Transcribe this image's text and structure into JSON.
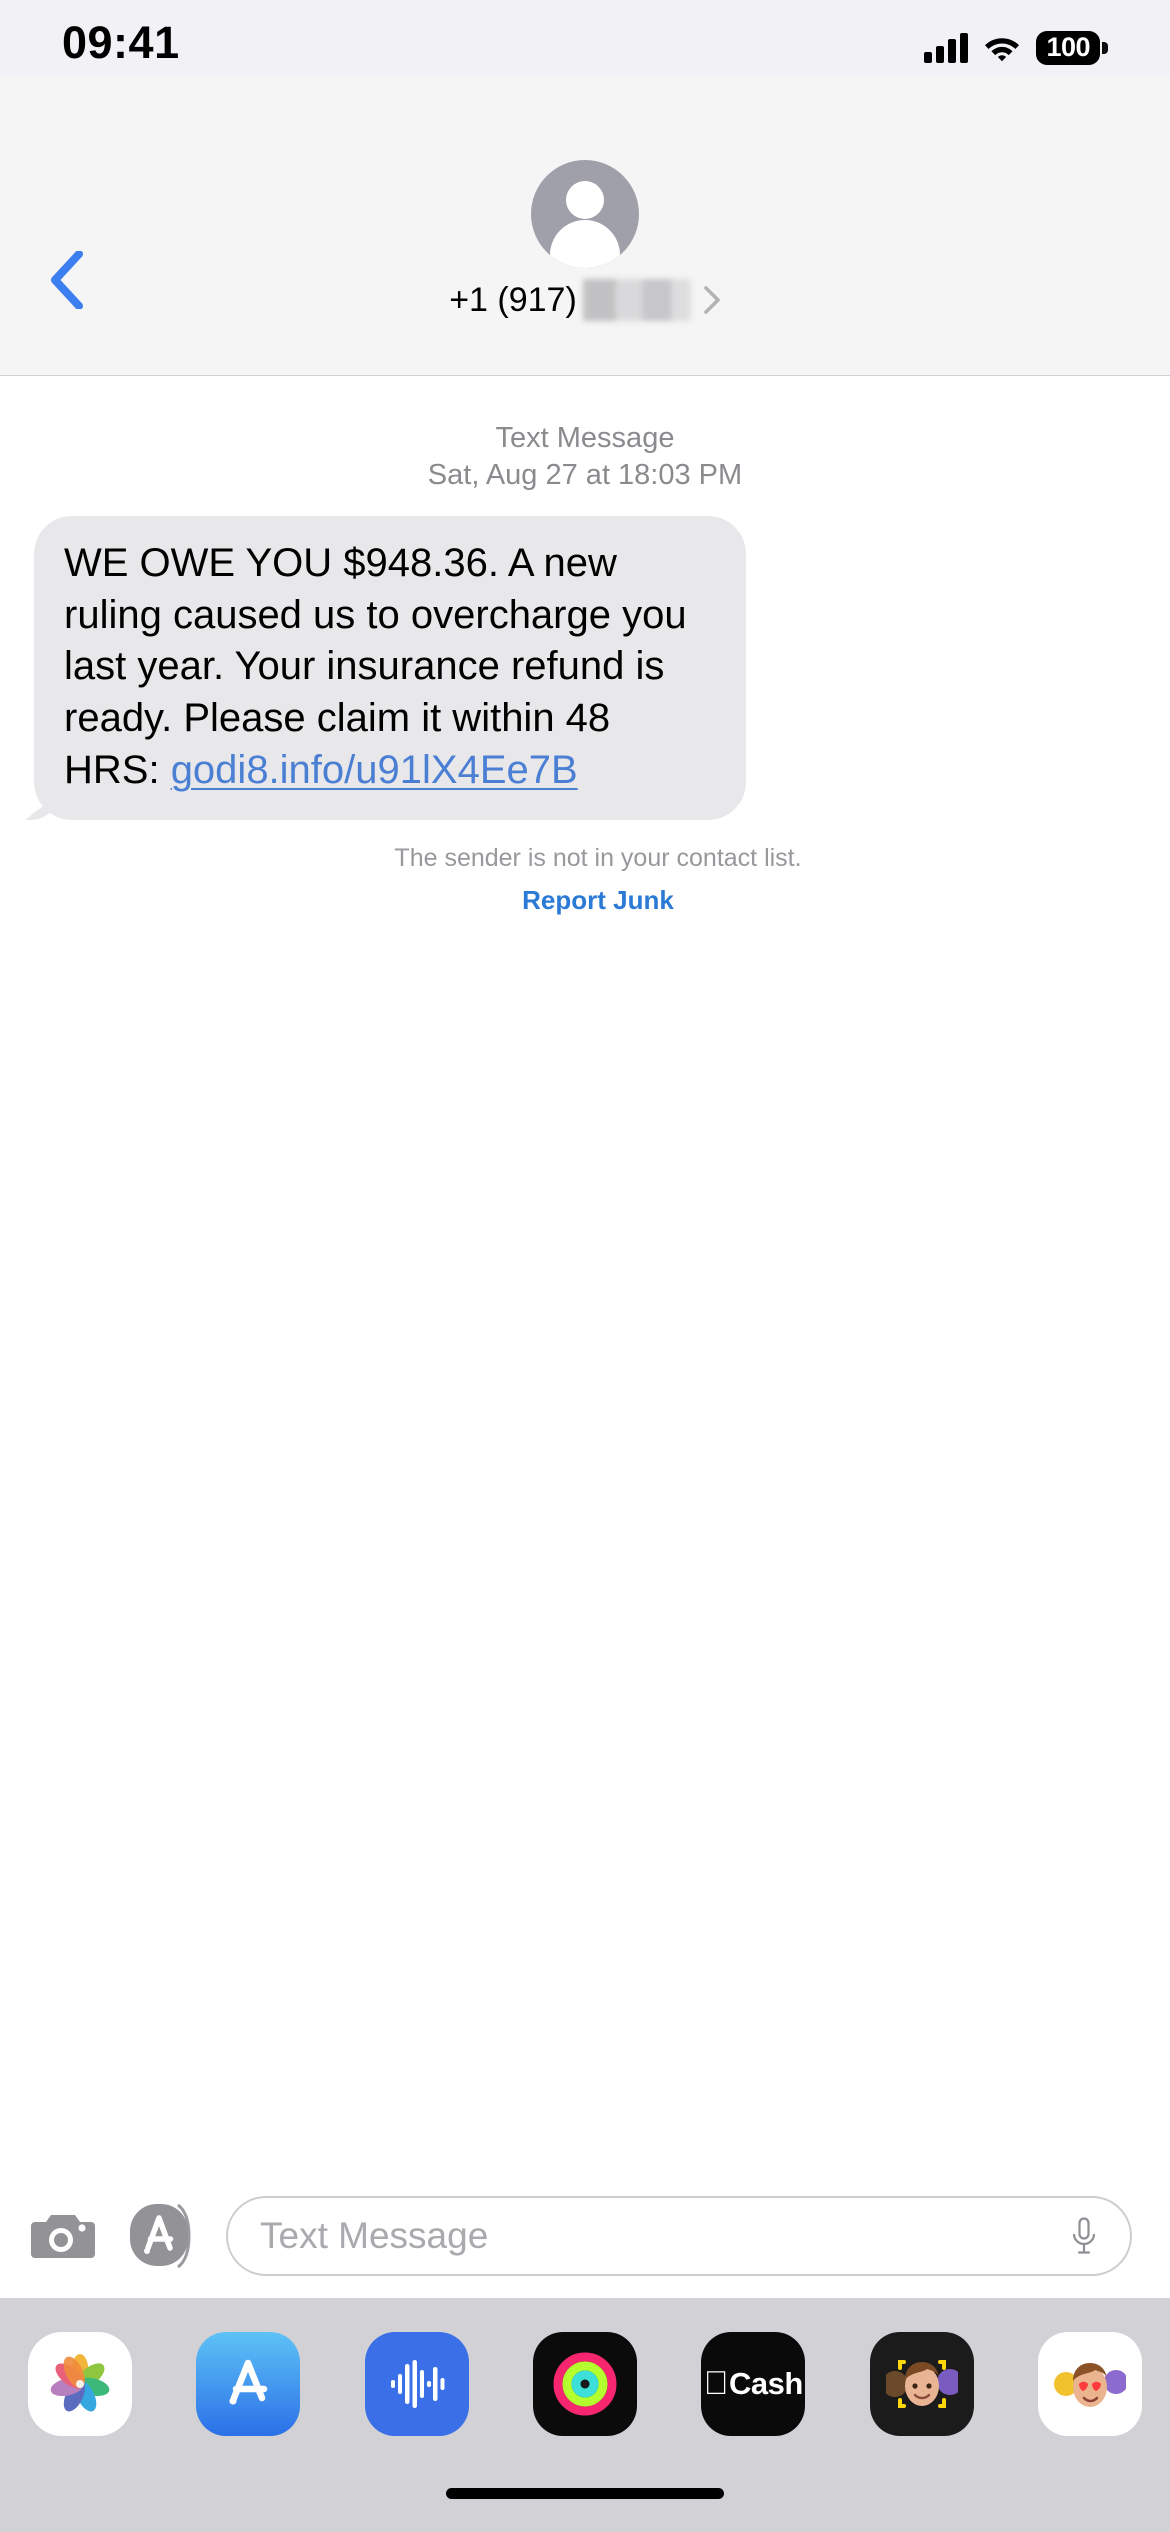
{
  "status_bar": {
    "time": "09:41",
    "signal_icon": "cellular-bars-icon",
    "wifi_icon": "wifi-icon",
    "battery_level": "100",
    "battery_icon": "battery-icon"
  },
  "nav": {
    "back_icon": "chevron-left-icon",
    "avatar_icon": "person-avatar-icon",
    "contact_name": "+1 (917)",
    "contact_redacted": true,
    "detail_chevron_icon": "chevron-right-icon"
  },
  "conversation": {
    "meta_type": "Text Message",
    "meta_timestamp": "Sat, Aug 27 at 18:03 PM",
    "message": {
      "body_before_link": "WE OWE YOU $948.36. A new ruling caused us to overcharge you last year. Your insurance refund is ready. Please claim it within 48 HRS: ",
      "link_text": "godi8.info/u91lX4Ee7B",
      "link_color": "#4b7fd4",
      "bubble_color": "#e8e8ea"
    },
    "junk_notice": "The sender is not in your contact list.",
    "report_junk_label": "Report Junk",
    "report_junk_color": "#2b7bd6"
  },
  "input_bar": {
    "camera_icon": "camera-icon",
    "appstore_icon": "app-store-icon",
    "placeholder": "Text Message",
    "mic_icon": "microphone-icon"
  },
  "app_drawer": {
    "apps": [
      {
        "name": "photos",
        "icon": "photos-icon",
        "label": "Photos"
      },
      {
        "name": "app-store",
        "icon": "app-store-icon",
        "label": "App Store"
      },
      {
        "name": "music",
        "icon": "music-waveform-icon",
        "label": "Music"
      },
      {
        "name": "fitness",
        "icon": "fitness-rings-icon",
        "label": "Fitness"
      },
      {
        "name": "apple-cash",
        "icon": "apple-cash-icon",
        "label": "Cash"
      },
      {
        "name": "memoji",
        "icon": "memoji-icon",
        "label": "Memoji"
      },
      {
        "name": "animoji-stickers",
        "icon": "animoji-stickers-icon",
        "label": "Stickers"
      }
    ],
    "cash_label": "Cash",
    "background_color": "#d1d1d6"
  },
  "home_indicator": "home-indicator"
}
